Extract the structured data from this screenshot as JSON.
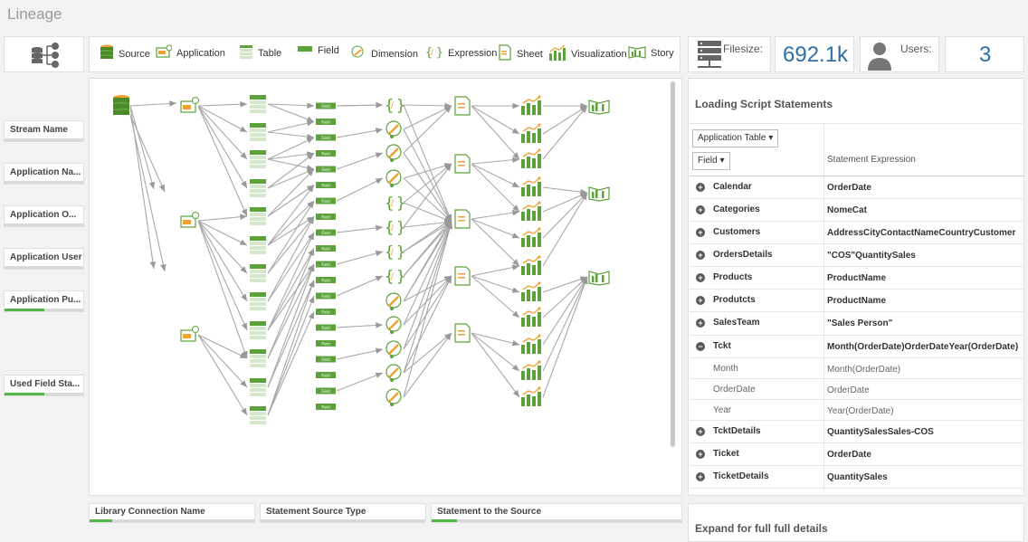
{
  "app_title": "Lineage",
  "legend": [
    {
      "icon": "database-icon",
      "label": "Source"
    },
    {
      "icon": "application-icon",
      "label": "Application"
    },
    {
      "icon": "table-icon",
      "label": "Table"
    },
    {
      "icon": "field-icon",
      "label": "Field"
    },
    {
      "icon": "dimension-icon",
      "label": "Dimension"
    },
    {
      "icon": "expression-icon",
      "label": "Expression"
    },
    {
      "icon": "sheet-icon",
      "label": "Sheet"
    },
    {
      "icon": "visualization-icon",
      "label": "Visualization"
    },
    {
      "icon": "story-icon",
      "label": "Story"
    }
  ],
  "kpis": {
    "filesize_label": "Filesize:",
    "filesize_value": "692.1k",
    "users_label": "Users:",
    "users_value": "3"
  },
  "filters": [
    {
      "label": "Stream Name",
      "fill": 0
    },
    {
      "label": "Application Na...",
      "fill": 0
    },
    {
      "label": "Application O...",
      "fill": 0
    },
    {
      "label": "Application User",
      "fill": 0
    },
    {
      "label": "Application Pu...",
      "fill": 0.5
    },
    {
      "label": "Used Field Sta...",
      "fill": 0.5
    }
  ],
  "bottom_filters": [
    {
      "label": "Library Connection Name",
      "fill": 0.14
    },
    {
      "label": "Statement Source Type",
      "fill": 0
    },
    {
      "label": "Statement to the Source",
      "fill": 0.1
    }
  ],
  "graph": {
    "field_node_label": "Field"
  },
  "script_panel": {
    "title": "Loading Script Statements",
    "dropdown_app_table": "Application Table",
    "dropdown_field": "Field",
    "column_expression": "Statement Expression",
    "rows": [
      {
        "name": "Calendar",
        "expr": "OrderDate",
        "type": "plus"
      },
      {
        "name": "Categories",
        "expr": "NomeCat",
        "type": "plus"
      },
      {
        "name": "Customers",
        "expr": "AddressCityContactNameCountryCustomer",
        "type": "plus"
      },
      {
        "name": "OrdersDetails",
        "expr": "\"COS\"QuantitySales",
        "type": "plus"
      },
      {
        "name": "Products",
        "expr": "ProductName",
        "type": "plus"
      },
      {
        "name": "Produtcts",
        "expr": "ProductName",
        "type": "plus"
      },
      {
        "name": "SalesTeam",
        "expr": "\"Sales Person\"",
        "type": "plus"
      },
      {
        "name": "Tckt",
        "expr": "Month(OrderDate)OrderDateYear(OrderDate)",
        "type": "minus"
      },
      {
        "name": "Month",
        "expr": "Month(OrderDate)",
        "type": "sub"
      },
      {
        "name": "OrderDate",
        "expr": "OrderDate",
        "type": "sub"
      },
      {
        "name": "Year",
        "expr": "Year(OrderDate)",
        "type": "sub"
      },
      {
        "name": "TcktDetails",
        "expr": "QuantitySalesSales-COS",
        "type": "plus"
      },
      {
        "name": "Ticket",
        "expr": "OrderDate",
        "type": "plus"
      },
      {
        "name": "TicketDetails",
        "expr": "QuantitySales",
        "type": "plus"
      }
    ],
    "footer": "Expand for full full details"
  },
  "colors": {
    "green": "#5da13a",
    "blue_value": "#2d6fa8",
    "orange": "#f0a030",
    "filter_fill": "#52b64a"
  }
}
